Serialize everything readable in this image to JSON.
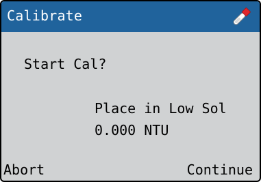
{
  "header": {
    "title": "Calibrate",
    "icon": "test-tube-icon"
  },
  "dialog": {
    "prompt": "Start Cal?",
    "instruction": "Place in Low Sol",
    "reading": "0.000 NTU"
  },
  "softkeys": {
    "left_label": "Abort",
    "right_label": "Continue"
  },
  "colors": {
    "title_bar": "#20639c",
    "screen_background": "#d0d2d3",
    "text": "#000000",
    "title_text": "#ffffff",
    "icon_cap": "#e0262b"
  }
}
